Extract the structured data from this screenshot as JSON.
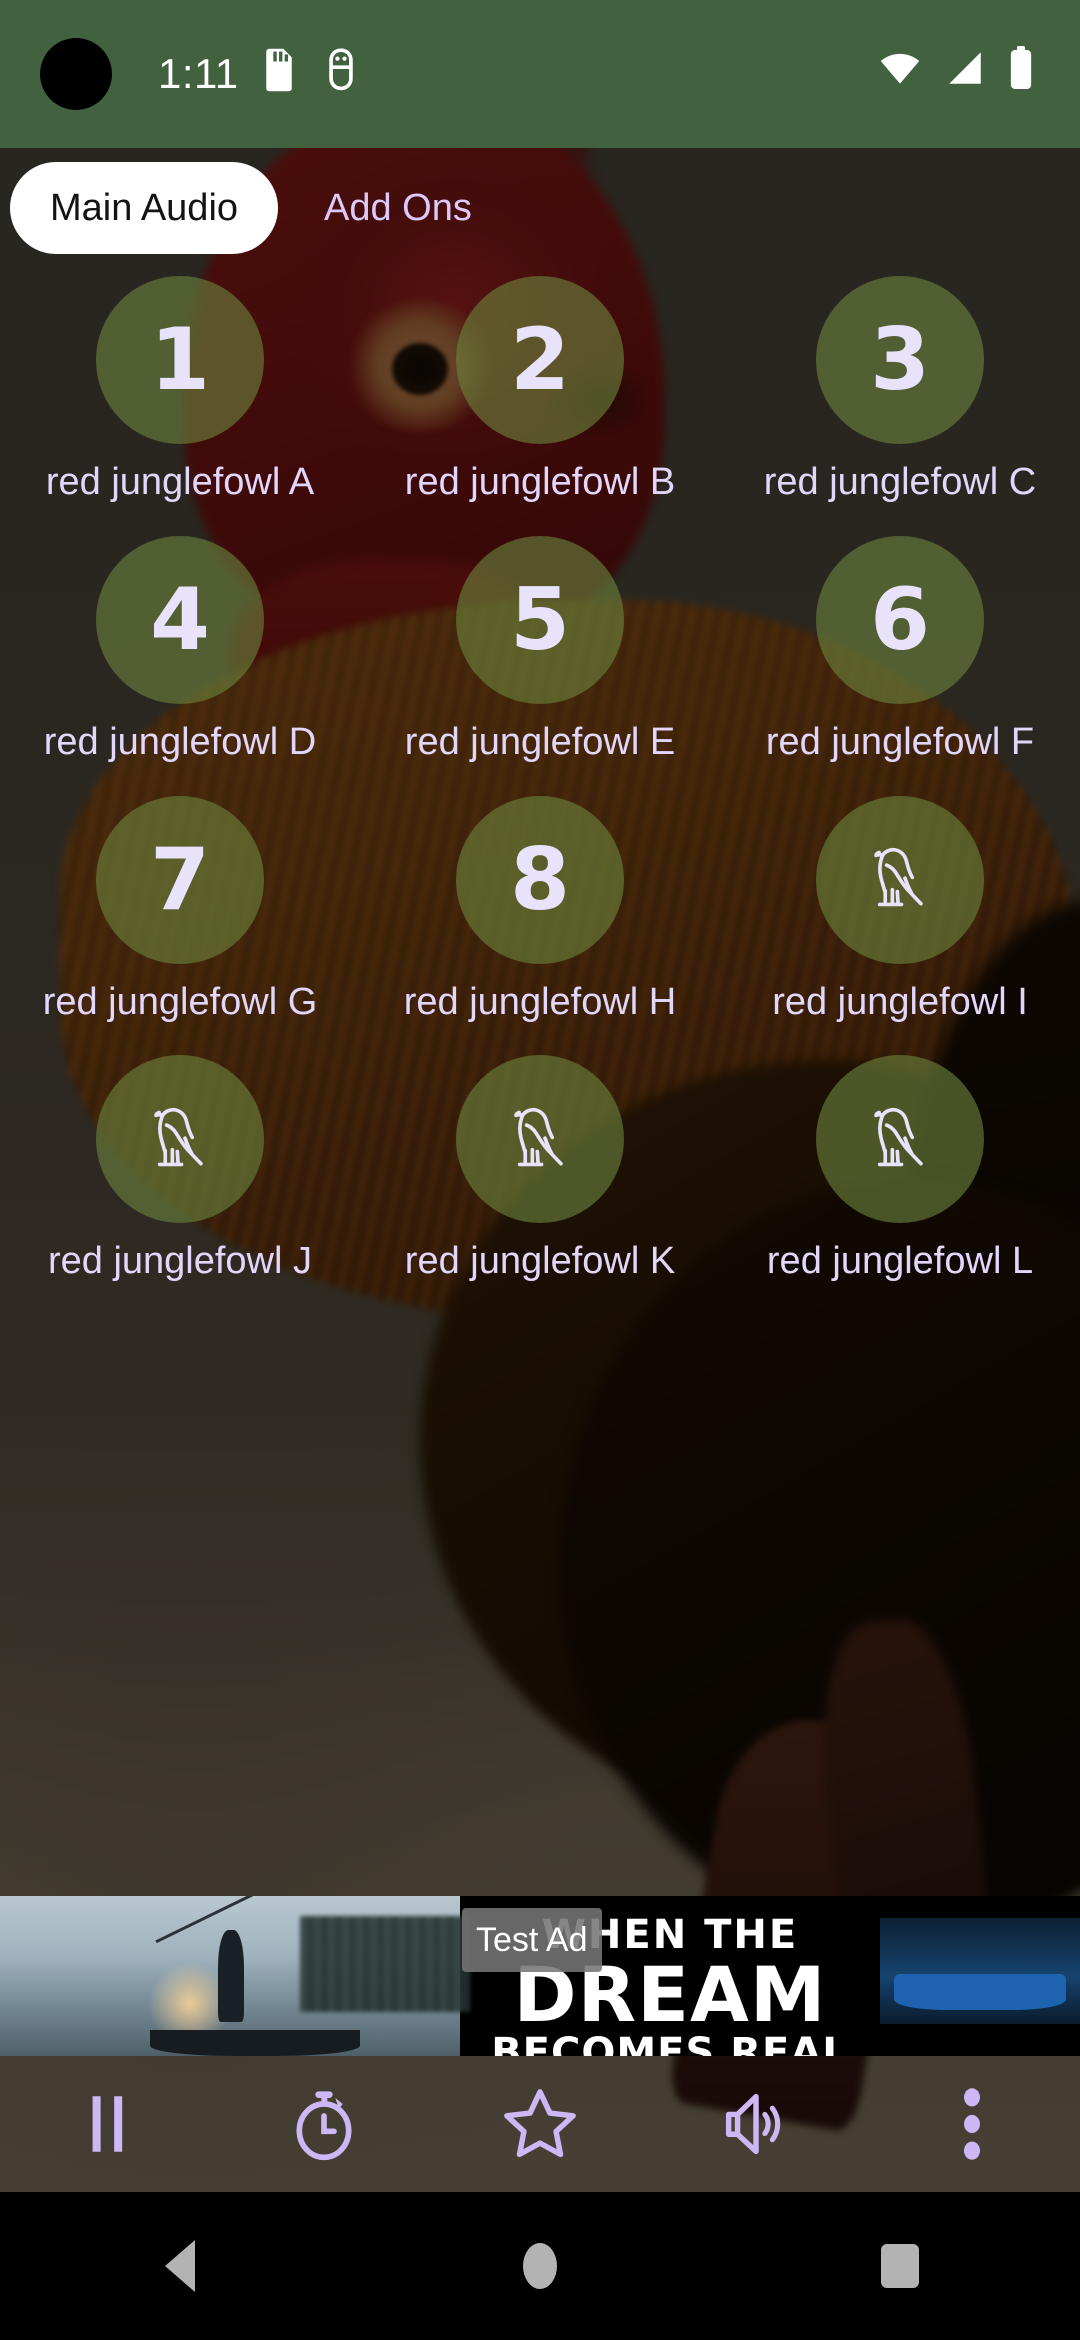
{
  "status_bar": {
    "time": "1:11",
    "background_color": "#41613f",
    "left_icons": [
      "sd-card-icon",
      "android-debug-icon"
    ],
    "right_icons": [
      "wifi-icon",
      "cellular-signal-icon",
      "battery-icon"
    ],
    "camera_cutout": "front-camera-cutout"
  },
  "tabs": {
    "items": [
      {
        "label": "Main Audio",
        "active": true
      },
      {
        "label": "Add Ons",
        "active": false
      }
    ],
    "active_text_color": "#131313",
    "inactive_text_color": "#ddc8fa",
    "active_pill_color": "#ffffff"
  },
  "grid": {
    "bubble_color": "rgba(108,130,62,0.62)",
    "number_color": "#e9e2fb",
    "label_color": "#e3d6fb",
    "items": [
      {
        "badge": "1",
        "badge_type": "number",
        "label": "red junglefowl A"
      },
      {
        "badge": "2",
        "badge_type": "number",
        "label": "red junglefowl B"
      },
      {
        "badge": "3",
        "badge_type": "number",
        "label": "red junglefowl C"
      },
      {
        "badge": "4",
        "badge_type": "number",
        "label": "red junglefowl D"
      },
      {
        "badge": "5",
        "badge_type": "number",
        "label": "red junglefowl E"
      },
      {
        "badge": "6",
        "badge_type": "number",
        "label": "red junglefowl F"
      },
      {
        "badge": "7",
        "badge_type": "number",
        "label": "red junglefowl G"
      },
      {
        "badge": "8",
        "badge_type": "number",
        "label": "red junglefowl H"
      },
      {
        "badge": "bird-icon",
        "badge_type": "icon",
        "label": "red junglefowl I"
      },
      {
        "badge": "bird-icon",
        "badge_type": "icon",
        "label": "red junglefowl J"
      },
      {
        "badge": "bird-icon",
        "badge_type": "icon",
        "label": "red junglefowl K"
      },
      {
        "badge": "bird-icon",
        "badge_type": "icon",
        "label": "red junglefowl L"
      }
    ]
  },
  "ad_banner": {
    "badge_label": "Test Ad",
    "headline_line1": "WHEN THE",
    "headline_line2": "DREAM",
    "headline_line3": "BECOMES REAL"
  },
  "controls": {
    "accent_color": "#cdb8f5",
    "buttons": [
      {
        "name": "pause-button",
        "icon": "pause-icon"
      },
      {
        "name": "timer-button",
        "icon": "stopwatch-icon"
      },
      {
        "name": "favorite-button",
        "icon": "star-icon"
      },
      {
        "name": "volume-button",
        "icon": "volume-icon"
      },
      {
        "name": "overflow-button",
        "icon": "more-vertical-icon"
      }
    ]
  },
  "nav_bar": {
    "buttons": [
      {
        "name": "back-button",
        "icon": "triangle-back-icon"
      },
      {
        "name": "home-button",
        "icon": "circle-home-icon"
      },
      {
        "name": "recents-button",
        "icon": "square-recents-icon"
      }
    ]
  }
}
